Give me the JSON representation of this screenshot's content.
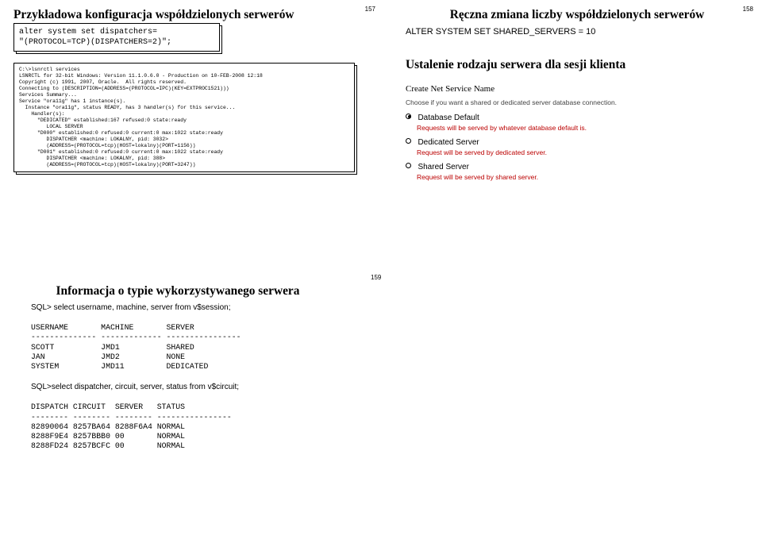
{
  "slide157": {
    "pagenum": "157",
    "title": "Przykładowa konfiguracja współdzielonych serwerów",
    "code": "alter system set dispatchers=\n\"(PROTOCOL=TCP)(DISPATCHERS=2)\";"
  },
  "slide157b": {
    "code": "C:\\>lsnrctl services\nLSNRCTL for 32-bit Windows: Version 11.1.0.6.0 - Production on 10-FEB-2008 12:18\nCopyright (c) 1991, 2007, Oracle.  All rights reserved.\nConnecting to (DESCRIPTION=(ADDRESS=(PROTOCOL=IPC)(KEY=EXTPROC1521)))\nServices Summary...\nService \"ora11g\" has 1 instance(s).\n  Instance \"ora11g\", status READY, has 3 handler(s) for this service...\n    Handler(s):\n      \"DEDICATED\" established:167 refused:0 state:ready\n         LOCAL SERVER\n      \"D000\" established:0 refused:0 current:0 max:1022 state:ready\n         DISPATCHER <machine: LOKALNY, pid: 3032>\n         (ADDRESS=(PROTOCOL=tcp)(HOST=lokalny)(PORT=1156))\n      \"D001\" established:0 refused:0 current:0 max:1022 state:ready\n         DISPATCHER <machine: LOKALNY, pid: 388>\n         (ADDRESS=(PROTOCOL=tcp)(HOST=lokalny)(PORT=3247))"
  },
  "slide158": {
    "pagenum": "158",
    "title": "Ręczna zmiana liczby współdzielonych serwerów",
    "cmd": "ALTER SYSTEM SET SHARED_SERVERS = 10",
    "subtitle": "Ustalenie rodzaju serwera dla sesji klienta",
    "panel": {
      "heading": "Create Net Service Name",
      "desc": "Choose if you want a shared or dedicated server database connection.",
      "opt1": "Database Default",
      "opt1desc": "Requests will be served by whatever database default is.",
      "opt2": "Dedicated Server",
      "opt2desc": "Request will be served by dedicated server.",
      "opt3": "Shared Server",
      "opt3desc": "Request will be served by shared server."
    }
  },
  "slide159": {
    "pagenum": "159",
    "title": "Informacja o typie wykorzystywanego serwera",
    "sql1": "SQL> select username, machine, server from v$session;",
    "table1": "USERNAME       MACHINE       SERVER\n-------------- ------------- ----------------\nSCOTT          JMD1          SHARED\nJAN            JMD2          NONE\nSYSTEM         JMD11         DEDICATED",
    "sql2": "SQL>select dispatcher, circuit, server, status from v$circuit;",
    "table2": "DISPATCH CIRCUIT  SERVER   STATUS\n-------- -------- -------- ----------------\n82890064 8257BA64 8288F6A4 NORMAL\n8288F9E4 8257BBB0 00       NORMAL\n8288FD24 8257BCFC 00       NORMAL"
  }
}
